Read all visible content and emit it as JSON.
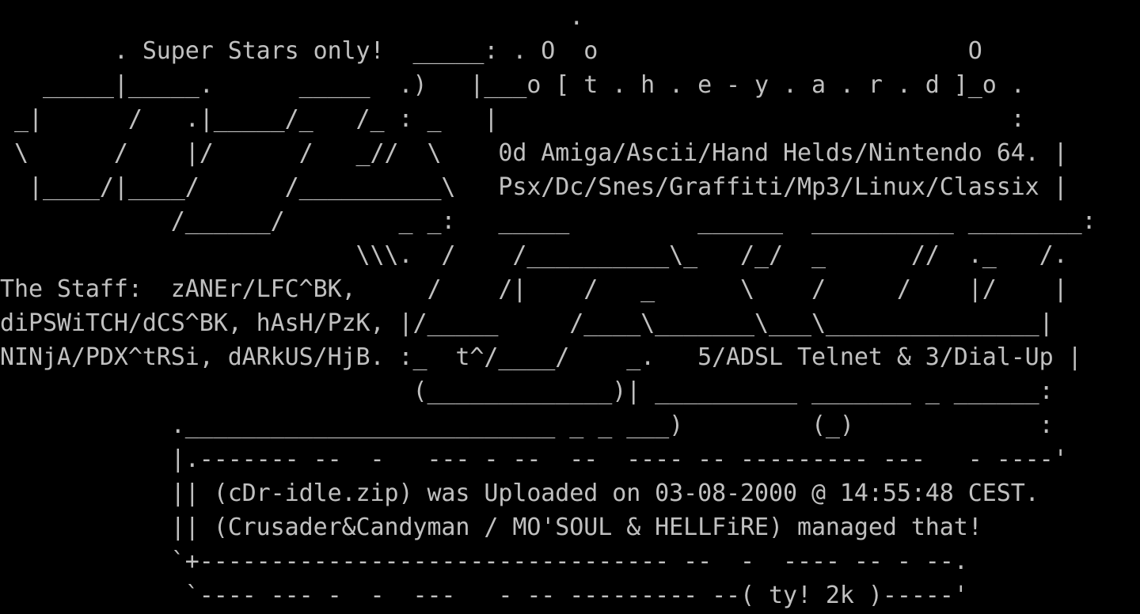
{
  "terminal": {
    "colors": {
      "background": "#000000",
      "foreground": "#c0c0c0"
    },
    "lines": [
      "                                        .",
      "        . Super Stars only!  _____: . O  o                          O",
      "   _____|_____.      _____  .)   |___o [ t . h . e - y . a . r . d ]_o .",
      " _|      /   .|_____/_   /_ : _   |                                    :",
      " \\      /    |/      /   _//  \\    0d Amiga/Ascii/Hand Helds/Nintendo 64. |",
      "  |____/|____/      /__________\\   Psx/Dc/Snes/Graffiti/Mp3/Linux/Classix |",
      "            /______/        _ _:   _____         ______  __________ ________:",
      "                         \\\\\\.  /    /__________\\_   /_/  _      //  ._   /.",
      "The Staff:  zANEr/LFC^BK,     /    /|    /   _      \\    /     /    |/    |",
      "diPSWiTCH/dCS^BK, hAsH/PzK, |/_____     /____\\_______\\___\\_______________|",
      "NINjA/PDX^tRSi, dARkUS/HjB. :_  t^/____/    _.   5/ADSL Telnet & 3/Dial-Up |",
      "                             (_____________)| __________ _______ _ ______:",
      "            .__________________________ _ _ ___)         (_)             :",
      "            |.------- --  -   --- - --  --  ---- -- --------- ---   - ----'",
      "            || (cDr-idle.zip) was Uploaded on 03-08-2000 @ 14:55:48 CEST.",
      "            || (Crusader&Candyman / MO'SOUL & HELLFiRE) managed that!",
      "            `+--------------------------------- --  -  ---- -- - --.",
      "             `---- --- -  -  ---   - -- --------- --( ty! 2k )-----'"
    ]
  }
}
